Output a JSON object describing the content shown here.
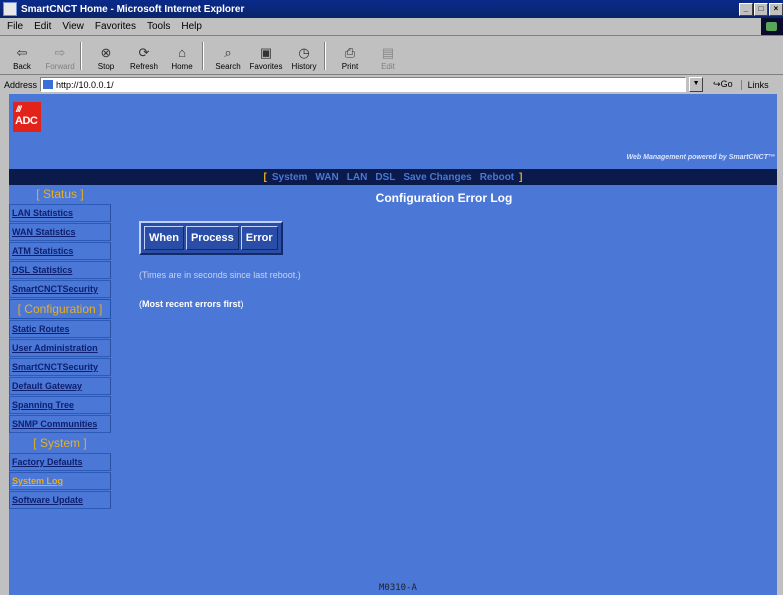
{
  "window": {
    "title": "SmartCNCT Home - Microsoft Internet Explorer",
    "controls": [
      "_",
      "□",
      "×"
    ]
  },
  "menu": [
    "File",
    "Edit",
    "View",
    "Favorites",
    "Tools",
    "Help"
  ],
  "toolbar": [
    {
      "label": "Back",
      "icon": "back-arrow-icon",
      "glyph": "⇦",
      "enabled": true
    },
    {
      "label": "Forward",
      "icon": "forward-arrow-icon",
      "glyph": "⇨",
      "enabled": false
    },
    {
      "label": "Stop",
      "icon": "stop-icon",
      "glyph": "⊗",
      "enabled": true
    },
    {
      "label": "Refresh",
      "icon": "refresh-icon",
      "glyph": "⟳",
      "enabled": true
    },
    {
      "label": "Home",
      "icon": "home-icon",
      "glyph": "⌂",
      "enabled": true
    },
    {
      "label": "Search",
      "icon": "search-icon",
      "glyph": "⌕",
      "enabled": true
    },
    {
      "label": "Favorites",
      "icon": "favorites-icon",
      "glyph": "▣",
      "enabled": true
    },
    {
      "label": "History",
      "icon": "history-icon",
      "glyph": "◷",
      "enabled": true
    },
    {
      "label": "Print",
      "icon": "print-icon",
      "glyph": "⎙",
      "enabled": true
    },
    {
      "label": "Edit",
      "icon": "edit-icon",
      "glyph": "▤",
      "enabled": false
    }
  ],
  "address": {
    "label": "Address",
    "value": "http://10.0.0.1/",
    "go": "Go",
    "links": "Links"
  },
  "brand": {
    "logo_text": "ADC",
    "logo_ticks": "///",
    "powered_by": "Web Management powered by SmartCNCT™",
    "logo_color": "#e2231a"
  },
  "nav": {
    "open": "[",
    "close": "]",
    "links": [
      "System",
      "WAN",
      "LAN",
      "DSL",
      "Save Changes",
      "Reboot"
    ]
  },
  "sidebar": {
    "status": {
      "heading": "Status",
      "items": [
        "LAN Statistics",
        "WAN Statistics",
        "ATM Statistics",
        "DSL Statistics",
        "SmartCNCTSecurity"
      ]
    },
    "configuration": {
      "heading": "Configuration",
      "items": [
        "Static Routes",
        "User Administration",
        "SmartCNCTSecurity",
        "Default Gateway",
        "Spanning Tree",
        "SNMP Communities"
      ]
    },
    "system": {
      "heading": "System",
      "items": [
        "Factory Defaults",
        "System Log",
        "Software Update"
      ],
      "active_index": 1
    }
  },
  "main": {
    "title": "Configuration Error Log",
    "columns": [
      "When",
      "Process",
      "Error"
    ],
    "note_times": "(Times are in seconds since last reboot.)",
    "note_recent": "Most recent errors first",
    "paren_open": "(",
    "paren_close": ")"
  },
  "footer": "M0310-A",
  "colors": {
    "page_bg": "#4b77d6",
    "nav_bg": "#0a1a4a",
    "accent": "#e8b020"
  }
}
